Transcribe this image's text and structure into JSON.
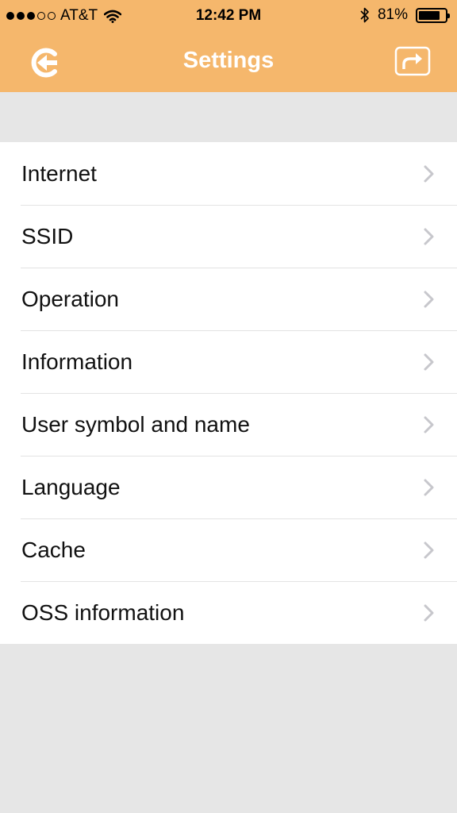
{
  "status_bar": {
    "carrier": "AT&T",
    "time": "12:42 PM",
    "battery_percent": "81%",
    "battery_level": 0.81,
    "signal_bars_filled": 3,
    "signal_bars_total": 5
  },
  "nav": {
    "title": "Settings",
    "back_icon": "back-arrow-circle-icon",
    "share_icon": "share-icon"
  },
  "settings": {
    "items": [
      {
        "label": "Internet"
      },
      {
        "label": "SSID"
      },
      {
        "label": "Operation"
      },
      {
        "label": "Information"
      },
      {
        "label": "User symbol and name"
      },
      {
        "label": "Language"
      },
      {
        "label": "Cache"
      },
      {
        "label": "OSS information"
      }
    ]
  },
  "colors": {
    "header": "#f5b76c",
    "background": "#e6e6e6",
    "list_background": "#ffffff"
  }
}
